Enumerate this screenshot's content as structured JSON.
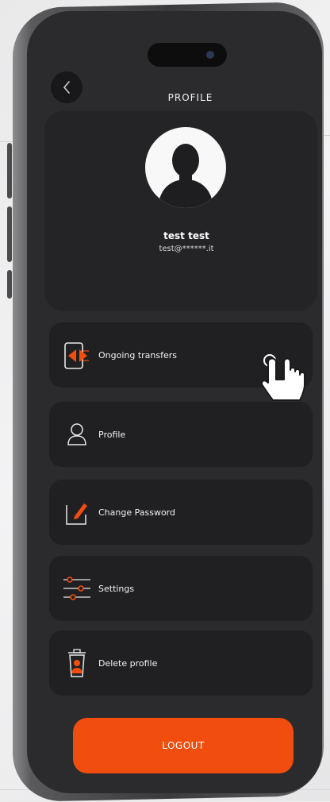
{
  "header": {
    "title": "PROFILE",
    "user_name": "test test",
    "user_email": "test@******.it"
  },
  "icons": {
    "back": "chevron-left-icon",
    "avatar": "user-silhouette-icon",
    "ongoing_transfers": "phone-transfer-icon",
    "profile": "user-outline-icon",
    "change_password": "edit-pencil-icon",
    "settings": "sliders-icon",
    "delete_profile": "trash-user-icon",
    "hand_cursor": "tap-hand-icon"
  },
  "menu": {
    "items": [
      {
        "label": "Ongoing transfers"
      },
      {
        "label": "Profile"
      },
      {
        "label": "Change Password"
      },
      {
        "label": "Settings"
      },
      {
        "label": "Delete profile"
      }
    ]
  },
  "actions": {
    "logout_label": "LOGOUT"
  },
  "colors": {
    "accent": "#f04d0e",
    "background": "#2b2b2d",
    "card": "#202022"
  }
}
